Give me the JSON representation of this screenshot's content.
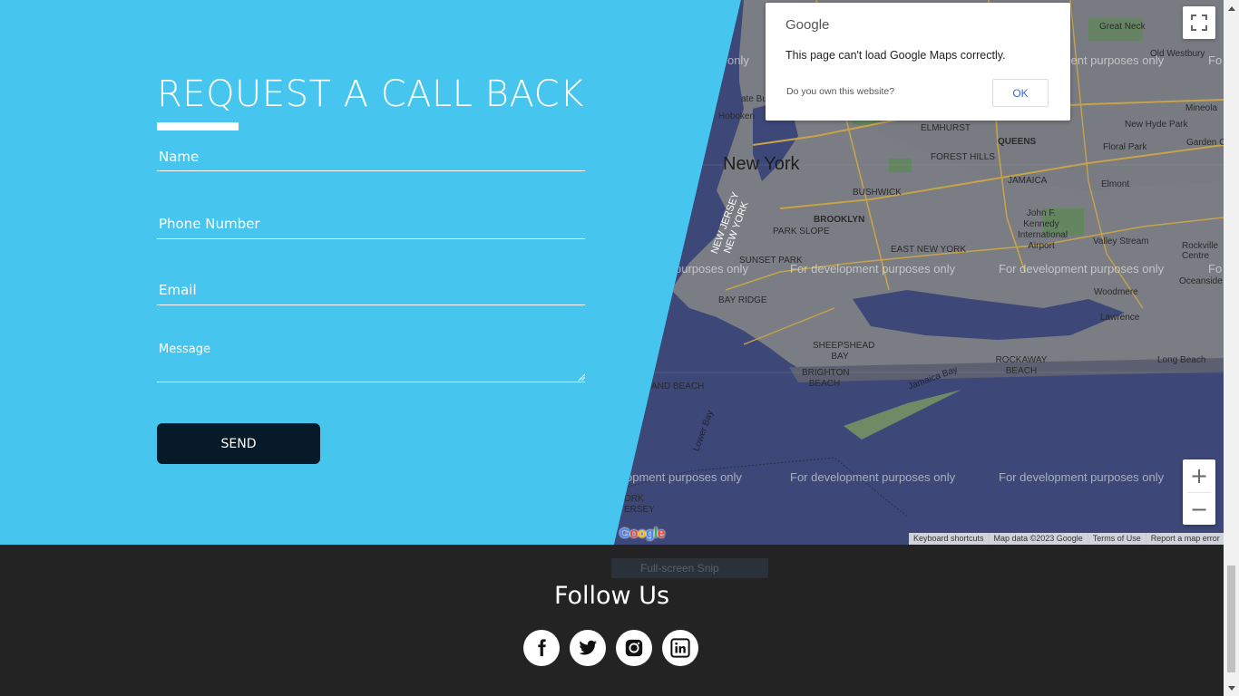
{
  "form": {
    "title": "REQUEST A CALL BACK",
    "name_placeholder": "Name",
    "phone_placeholder": "Phone Number",
    "email_placeholder": "Email",
    "message_placeholder": "Message",
    "send_label": "SEND"
  },
  "map": {
    "city_label": "New York",
    "dev_watermark": "For development purposes only",
    "dev_watermark_partial_left": "opment purposes only",
    "dev_watermark_partial_mid": "purposes only",
    "dev_watermark_partial_right": "Fo",
    "dev_watermark_partial_top_left": "only",
    "labels": {
      "great_neck": "Great Neck",
      "old_westbury": "Old Westbury",
      "hoboken": "Hoboken",
      "elmhurst": "ELMHURST",
      "forest_hills": "FOREST HILLS",
      "queens": "QUEENS",
      "new_hyde_park": "New Hyde Park",
      "mineola": "Mineola",
      "floral_park": "Floral Park",
      "garden_city": "Garden C",
      "jamaica": "JAMAICA",
      "bushwick": "BUSHWICK",
      "elmont": "Elmont",
      "brooklyn": "BROOKLYN",
      "jfk": "John F. Kennedy International Airport",
      "valley_stream": "Valley Stream",
      "rockville": "Rockville Centre",
      "new_jersey": "NEW JERSEY",
      "new_york_state": "NEW YORK",
      "park_slope": "PARK SLOPE",
      "east_new_york": "EAST NEW YORK",
      "sunset_park": "SUNSET PARK",
      "oceanside": "Oceanside",
      "woodmere": "Woodmere",
      "bay_ridge": "BAY RIDGE",
      "lawrence": "Lawrence",
      "sheepshead_bay": "SHEEPSHEAD BAY",
      "rockaway_beach": "ROCKAWAY BEACH",
      "long_beach": "Long Beach",
      "brighton_beach": "BRIGHTON BEACH",
      "island_beach": "AND BEACH",
      "lower_bay": "Lower Bay",
      "jamaica_bay": "Jamaica Bay",
      "york_jersey": "ORK ERSEY",
      "state_building": "ate Buil"
    },
    "dialog": {
      "brand": "Google",
      "message": "This page can't load Google Maps correctly.",
      "own_site": "Do you own this website?",
      "ok_label": "OK"
    },
    "logo_letters": [
      "G",
      "o",
      "o",
      "g",
      "l",
      "e"
    ],
    "logo_colors": [
      "#4285F4",
      "#EA4335",
      "#FBBC05",
      "#4285F4",
      "#34A853",
      "#EA4335"
    ],
    "attribution": {
      "keyboard": "Keyboard shortcuts",
      "map_data": "Map data ©2023 Google",
      "terms": "Terms of Use",
      "report": "Report a map error"
    },
    "zoom_in_symbol": "+",
    "zoom_out_symbol": "−"
  },
  "footer": {
    "snip_label": "Full-screen Snip",
    "follow_title": "Follow Us",
    "socials": [
      "facebook-icon",
      "twitter-icon",
      "instagram-icon",
      "linkedin-icon"
    ]
  },
  "colors": {
    "contact_bg": "#46c6ee",
    "send_button": "#061a27",
    "footer_bg": "#232323"
  }
}
